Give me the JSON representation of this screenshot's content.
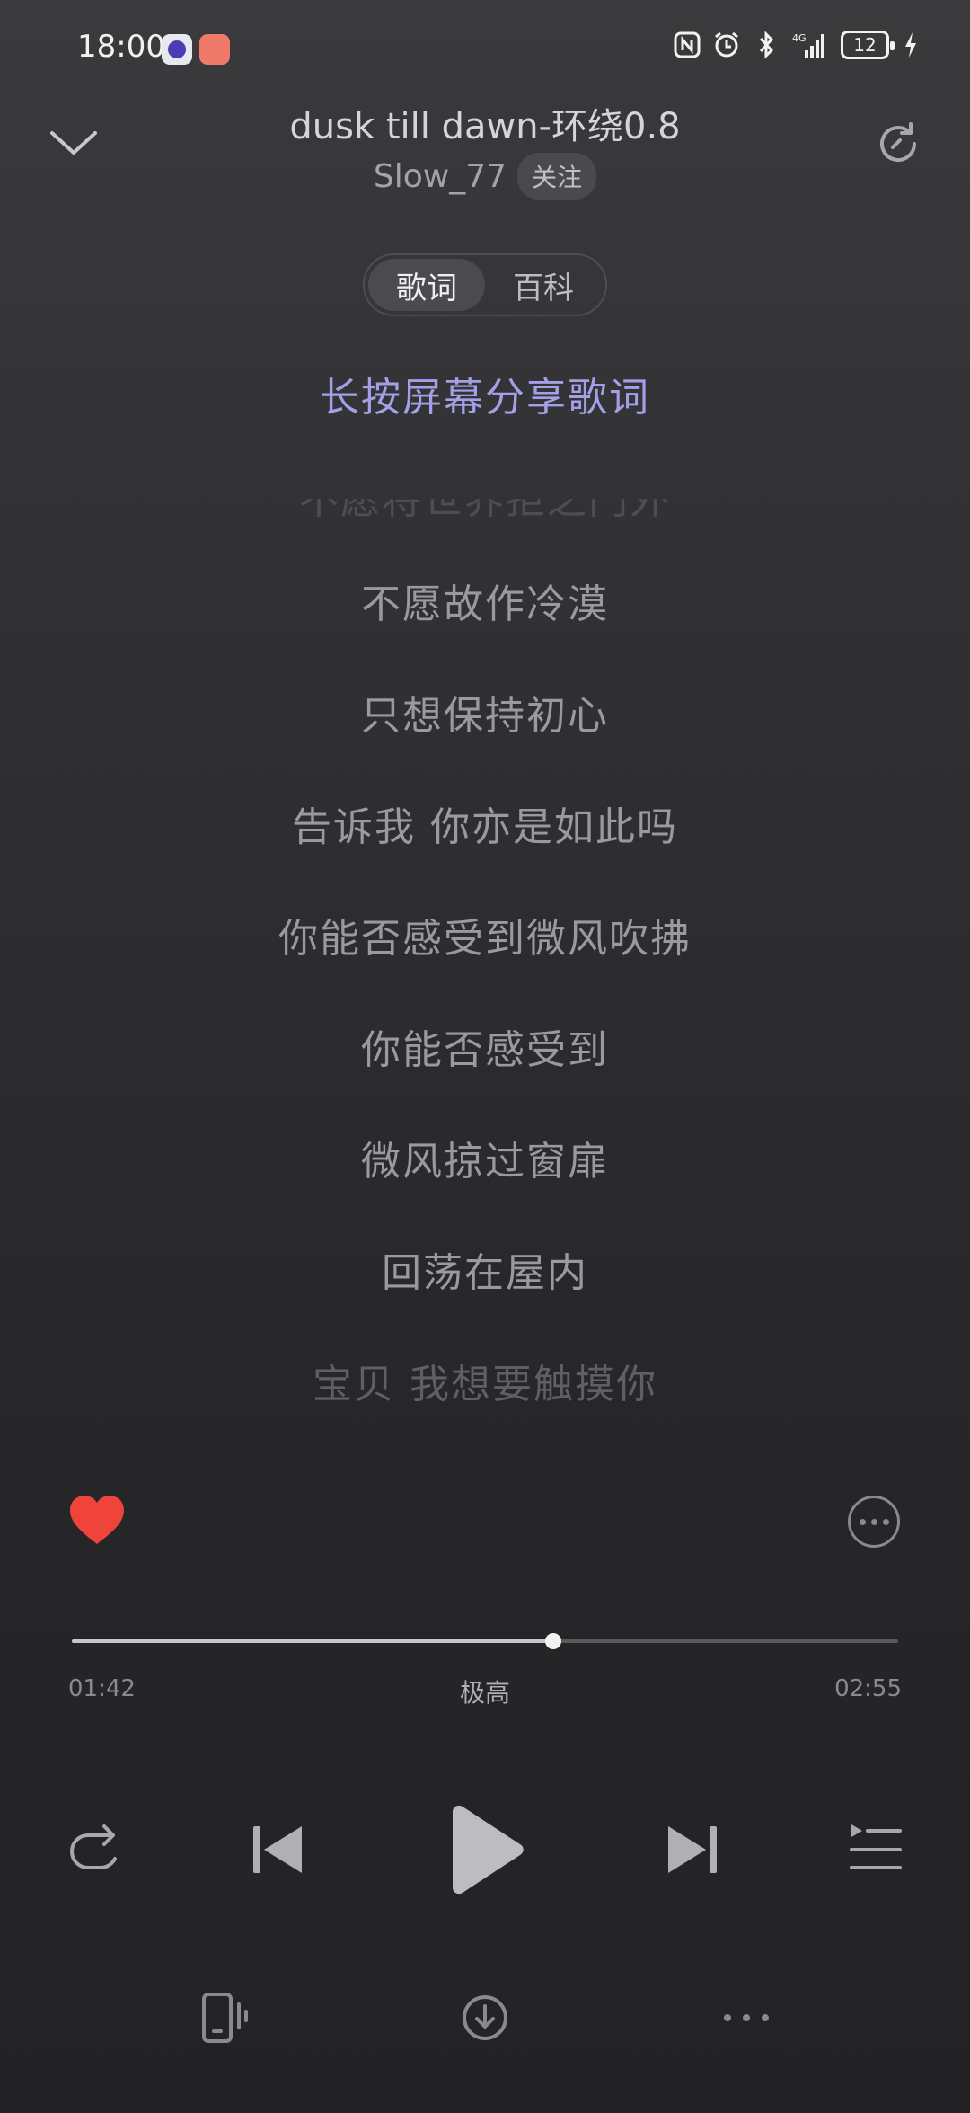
{
  "status_bar": {
    "time": "18:00",
    "battery_level": "12"
  },
  "header": {
    "song_title": "dusk till dawn-环绕0.8",
    "artist": "Slow_77",
    "follow_label": "关注"
  },
  "tabs": [
    {
      "label": "歌词",
      "active": true
    },
    {
      "label": "百科",
      "active": false
    }
  ],
  "share_hint": "长按屏幕分享歌词",
  "lyrics": [
    "不愿将世界拒之门外",
    "不愿故作冷漠",
    "只想保持初心",
    "告诉我 你亦是如此吗",
    "你能否感受到微风吹拂",
    "你能否感受到",
    "微风掠过窗扉",
    "回荡在屋内",
    "宝贝 我想要触摸你"
  ],
  "player": {
    "liked": true,
    "progress": 0.583,
    "current_time": "01:42",
    "total_time": "02:55",
    "quality": "极高"
  },
  "colors": {
    "accent_lyric_hint": "#a3a0e8",
    "like_red": "#f0433a",
    "background": "#2a2a2c"
  },
  "icons": {
    "collapse": "chevron-down-icon",
    "refresh": "refresh-icon",
    "like": "heart-icon",
    "more": "more-circle-icon",
    "repeat": "repeat-icon",
    "prev": "skip-previous-icon",
    "play": "play-icon",
    "next": "skip-next-icon",
    "playlist": "playlist-icon",
    "device": "device-switch-icon",
    "download": "download-icon",
    "bottom_more": "more-dots-icon"
  }
}
